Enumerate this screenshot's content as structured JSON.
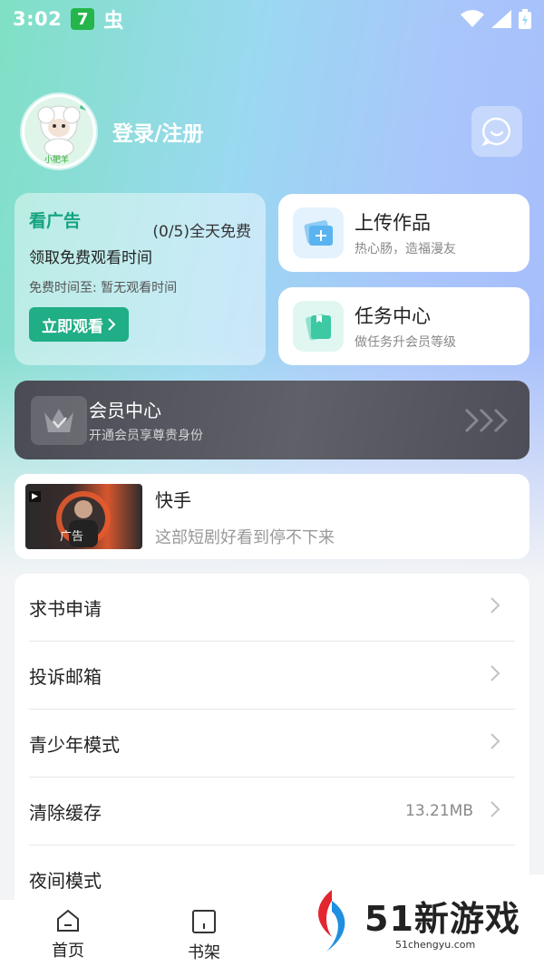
{
  "status_bar": {
    "time": "3:02",
    "badge": "7",
    "bug_glyph": "虫"
  },
  "profile": {
    "login_label": "登录/注册",
    "avatar_caption": "小肥羊"
  },
  "ad_card": {
    "title": "看广告",
    "count": "(0/5)全天免费",
    "description": "领取免费观看时间",
    "free_time": "免费时间至: 暂无观看时间",
    "button": "立即观看"
  },
  "upload_card": {
    "title": "上传作品",
    "subtitle": "热心肠，造福漫友"
  },
  "task_card": {
    "title": "任务中心",
    "subtitle": "做任务升会员等级"
  },
  "vip_card": {
    "title": "会员中心",
    "subtitle": "开通会员享尊贵身份"
  },
  "ad_banner": {
    "title": "快手",
    "subtitle": "这部短剧好看到停不下来",
    "thumb_label": "广告"
  },
  "menu": [
    {
      "label": "求书申请"
    },
    {
      "label": "投诉邮箱"
    },
    {
      "label": "青少年模式"
    },
    {
      "label": "清除缓存",
      "value": "13.21MB"
    },
    {
      "label": "夜间模式"
    }
  ],
  "bottom_nav": [
    {
      "label": "首页"
    },
    {
      "label": "书架"
    }
  ],
  "watermark": {
    "brand": "51新游戏",
    "url": "51chengyu.com"
  },
  "colors": {
    "accent_green": "#1fae86",
    "vip_bg": "#4a4b54",
    "gradient_start": "#7fe0c4",
    "gradient_end": "#a6bcfb"
  }
}
